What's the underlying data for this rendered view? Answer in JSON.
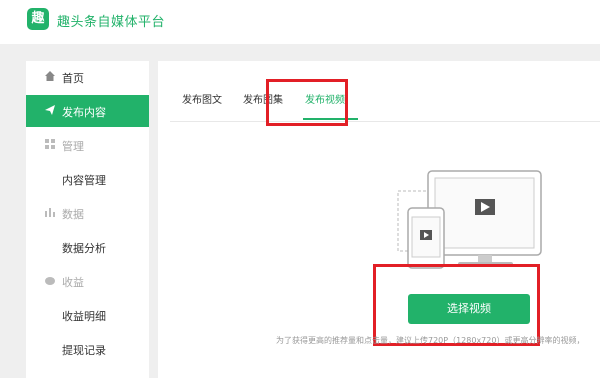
{
  "header": {
    "logo_char": "趣",
    "brand": "趣头条自媒体平台"
  },
  "sidebar": {
    "items": [
      {
        "label": "首页",
        "icon": "home-icon"
      },
      {
        "label": "发布内容",
        "icon": "send-icon"
      },
      {
        "label": "管理",
        "icon": "grid-icon"
      },
      {
        "label": "内容管理"
      },
      {
        "label": "数据",
        "icon": "bar-chart-icon"
      },
      {
        "label": "数据分析"
      },
      {
        "label": "收益",
        "icon": "coin-icon"
      },
      {
        "label": "收益明细"
      },
      {
        "label": "提现记录"
      }
    ]
  },
  "tabs": [
    {
      "label": "发布图文"
    },
    {
      "label": "发布图集"
    },
    {
      "label": "发布视频"
    }
  ],
  "main": {
    "select_button": "选择视频",
    "hint": "为了获得更高的推荐量和点击量，建议上传720P（1280x720）或更高分辨率的视频，"
  },
  "colors": {
    "accent": "#22b26a",
    "highlight": "#e21f26"
  }
}
